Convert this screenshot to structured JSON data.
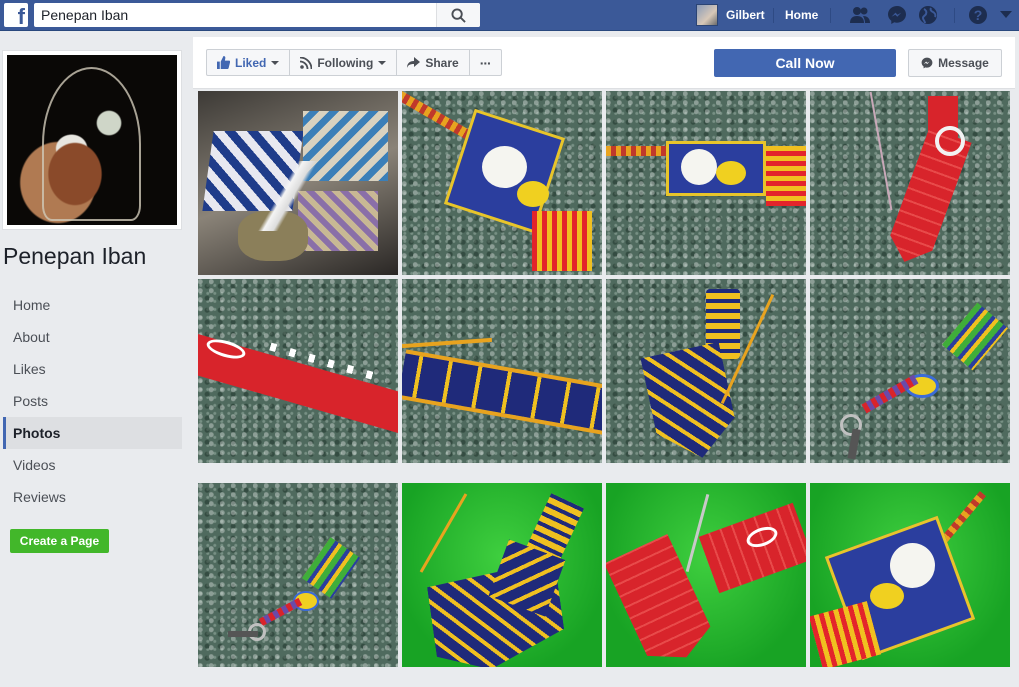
{
  "topbar": {
    "logo": "f",
    "search_value": "Penepan Iban",
    "user_name": "Gilbert",
    "home_label": "Home",
    "icons": [
      "search-icon",
      "friends-icon",
      "messenger-icon",
      "globe-icon",
      "help-icon",
      "chevron-down-icon"
    ],
    "help_glyph": "?"
  },
  "sidebar": {
    "page_name": "Penepan Iban",
    "items": [
      {
        "label": "Home",
        "active": false
      },
      {
        "label": "About",
        "active": false
      },
      {
        "label": "Likes",
        "active": false
      },
      {
        "label": "Posts",
        "active": false
      },
      {
        "label": "Photos",
        "active": true
      },
      {
        "label": "Videos",
        "active": false
      },
      {
        "label": "Reviews",
        "active": false
      }
    ],
    "create_page_label": "Create a Page"
  },
  "actions": {
    "liked_label": "Liked",
    "following_label": "Following",
    "share_label": "Share",
    "more_label": "···",
    "call_now_label": "Call Now",
    "message_label": "Message"
  },
  "colors": {
    "brand": "#3b5998",
    "primary_button": "#4267b2",
    "create_button": "#42b72a"
  },
  "photos": [
    {
      "subject": "woven baskets and bird feathers",
      "bg": "dark"
    },
    {
      "subject": "beaded necklace with cat face",
      "bg": "granite"
    },
    {
      "subject": "beaded necklace with cat face, horizontal",
      "bg": "granite"
    },
    {
      "subject": "red beaded tie with spiral motif",
      "bg": "granite"
    },
    {
      "subject": "red beaded strap with lettering",
      "bg": "granite"
    },
    {
      "subject": "blue and yellow beaded strap",
      "bg": "granite"
    },
    {
      "subject": "yellow and navy beaded necklace",
      "bg": "granite"
    },
    {
      "subject": "beaded keychain with tassel",
      "bg": "granite"
    },
    {
      "subject": "beaded keychain with tassel",
      "bg": "granite"
    },
    {
      "subject": "yellow and navy beaded necklace on green",
      "bg": "green"
    },
    {
      "subject": "red beaded tie on green",
      "bg": "green"
    },
    {
      "subject": "beaded necklace with owl face on green",
      "bg": "green"
    }
  ]
}
